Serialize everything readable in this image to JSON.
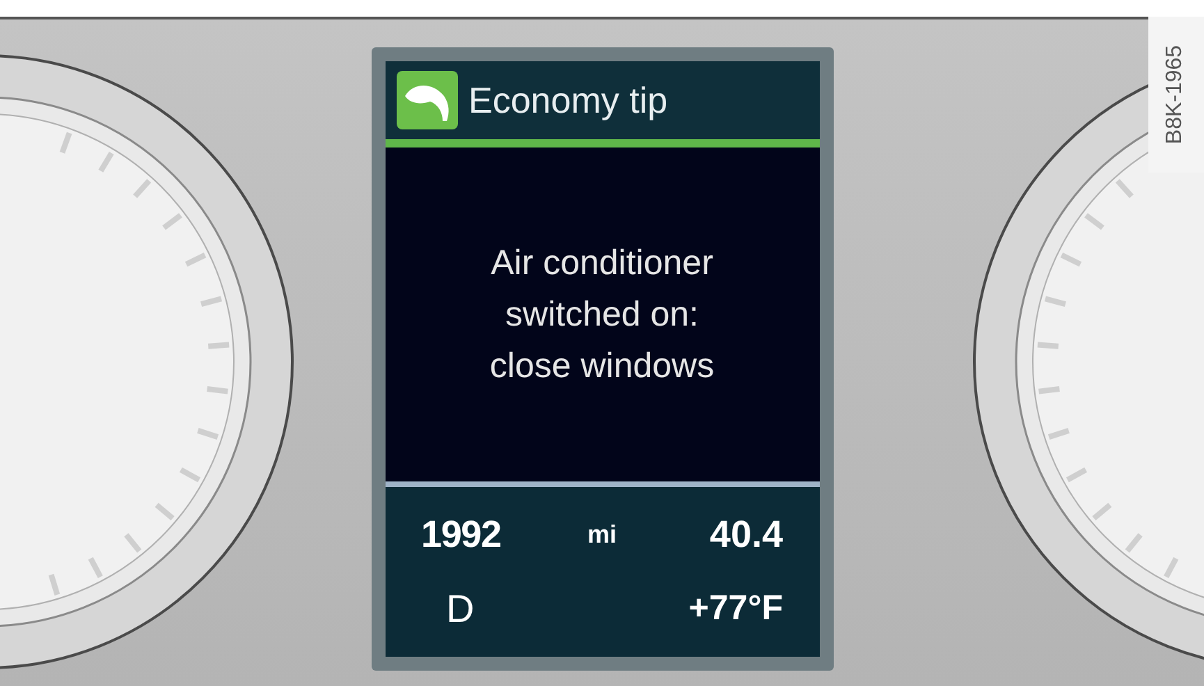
{
  "display": {
    "header": {
      "title": "Economy tip"
    },
    "message_lines": [
      "Air conditioner",
      "switched on:",
      "close windows"
    ],
    "trip": {
      "distance": "1992",
      "unit": "mi",
      "consumption": "40.4"
    },
    "status": {
      "gear": "D",
      "temperature": "+77°F"
    }
  },
  "figure_code": "B8K-1965"
}
